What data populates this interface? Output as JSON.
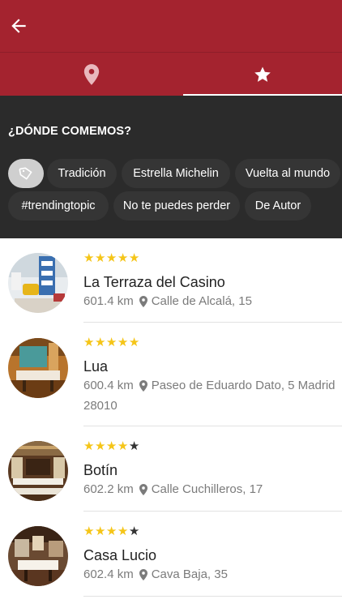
{
  "header": {
    "back_icon": "arrow-back-icon"
  },
  "tabs": [
    {
      "icon": "location-pin-icon",
      "selected": false
    },
    {
      "icon": "star-icon",
      "selected": true
    }
  ],
  "filters": {
    "title": "¿DÓNDE COMEMOS?",
    "tag_icon": "tag-icon",
    "chips": [
      "Tradición",
      "Estrella Michelin",
      "Vuelta al mundo",
      "#trendingtopic",
      "No te puedes perder",
      "De Autor"
    ]
  },
  "restaurants": [
    {
      "name": "La Terraza del Casino",
      "rating": 5,
      "distance": "601.4 km",
      "address": "Calle de Alcalá, 15",
      "address_line2": ""
    },
    {
      "name": "Lua",
      "rating": 5,
      "distance": "600.4 km",
      "address": "Paseo de Eduardo Dato, 5 Madrid",
      "address_line2": "28010"
    },
    {
      "name": "Botín",
      "rating": 4,
      "distance": "602.2 km",
      "address": "Calle Cuchilleros, 17",
      "address_line2": ""
    },
    {
      "name": "Casa Lucio",
      "rating": 4,
      "distance": "602.4 km",
      "address": "Cava Baja, 35",
      "address_line2": ""
    }
  ],
  "colors": {
    "primary": "#a4232f",
    "filter_bg": "#2b2b2b",
    "star": "#f5c518"
  }
}
